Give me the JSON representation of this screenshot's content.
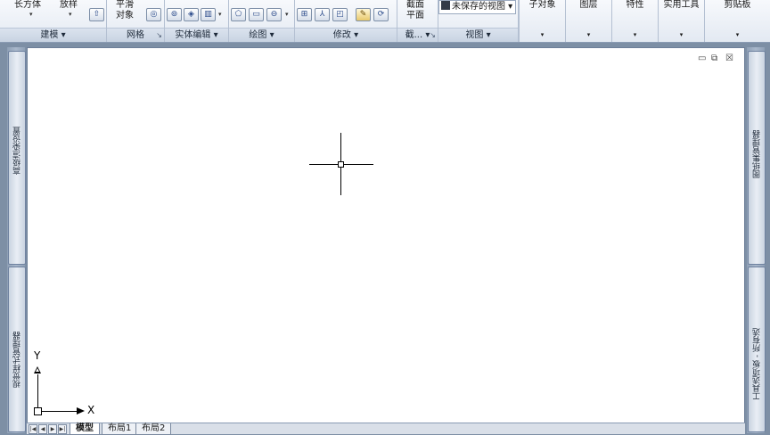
{
  "ribbon": {
    "panels": {
      "modeling": {
        "title": "建模",
        "box_label": "长方体",
        "loft_label": "放样"
      },
      "mesh": {
        "title": "网格",
        "smooth_label_1": "平滑",
        "smooth_label_2": "对象"
      },
      "solid_edit": {
        "title": "实体编辑"
      },
      "draw": {
        "title": "绘图"
      },
      "modify": {
        "title": "修改"
      },
      "section": {
        "title": "截...",
        "section_plane_1": "截面",
        "section_plane_2": "平面"
      },
      "view": {
        "title": "视图",
        "named_view": "未保存的视图"
      },
      "subobject": {
        "label": "子对象"
      },
      "layers": {
        "label": "图层"
      },
      "properties": {
        "label": "特性"
      },
      "utilities": {
        "label": "实用工具"
      },
      "clipboard": {
        "label": "剪贴板"
      }
    }
  },
  "palettes": {
    "left_top": "高级渲染设置",
    "left_bottom": "视觉样式管理器",
    "right_top": "图纸集管理器",
    "right_bottom": "工具选项板 - 所有选"
  },
  "ucs": {
    "x_label": "X",
    "y_label": "Y"
  },
  "window_controls": {
    "minimize": "▭",
    "restore": "⧉",
    "close": "☒"
  },
  "layout_tabs": [
    "模型",
    "布局1",
    "布局2"
  ],
  "nav_buttons": [
    "|◀",
    "◀",
    "▶",
    "▶|"
  ]
}
